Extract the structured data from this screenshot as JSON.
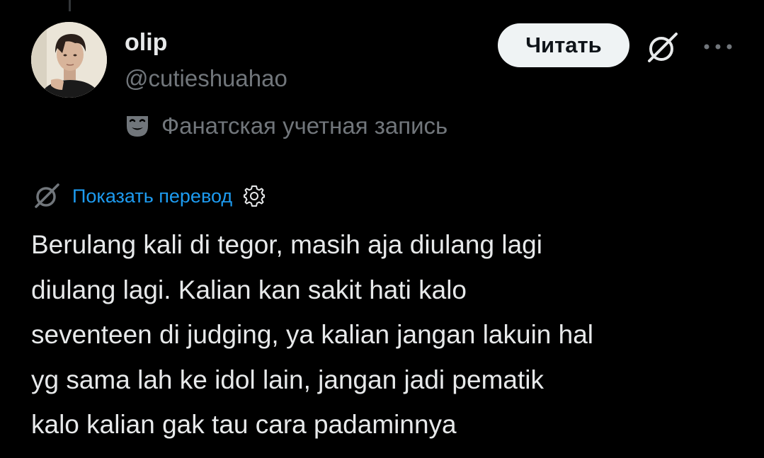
{
  "author": {
    "display_name": "olip",
    "handle": "@cutieshuahao",
    "avatar_icon": "profile-photo"
  },
  "actions": {
    "follow_label": "Читать",
    "grok_icon": "grok-slash-circle-icon",
    "more_icon": "more-dots-icon"
  },
  "fan_account": {
    "icon": "theater-mask-icon",
    "label": "Фанатская учетная запись"
  },
  "translation": {
    "link_label": "Показать перевод",
    "grok_icon": "grok-slash-circle-icon",
    "settings_icon": "gear-icon"
  },
  "tweet": {
    "text": "Berulang kali di tegor, masih aja diulang lagi\ndiulang lagi. Kalian kan sakit hati kalo\nseventeen di judging, ya kalian jangan lakuin hal\nyg sama lah ke idol lain, jangan jadi pematik\nkalo kalian gak tau cara padaminnya"
  },
  "colors": {
    "background": "#000000",
    "primary_text": "#e7e9ea",
    "secondary_text": "#71767b",
    "link": "#1d9bf0",
    "button_bg": "#eff3f4",
    "button_text": "#0f1419"
  }
}
